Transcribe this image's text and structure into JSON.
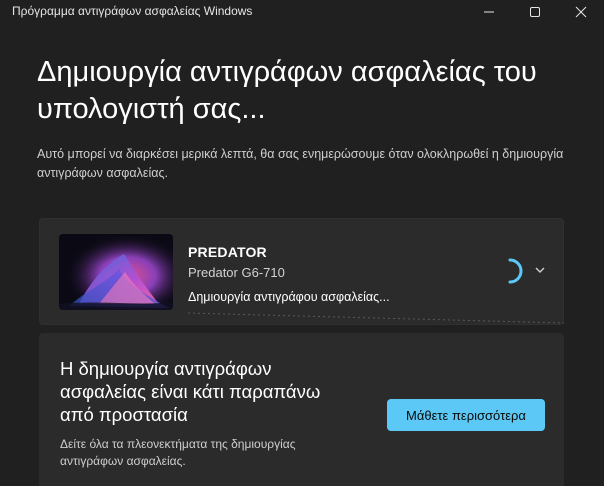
{
  "window": {
    "title": "Πρόγραμμα αντιγράφων ασφαλείας Windows"
  },
  "main": {
    "heading": "Δημιουργία αντιγράφων ασφαλείας του υπολογιστή σας...",
    "description": "Αυτό μπορεί να διαρκέσει μερικά λεπτά, θα σας ενημερώσουμε όταν ολοκληρωθεί η δημιουργία αντιγράφων ασφαλείας."
  },
  "device": {
    "name": "PREDATOR",
    "model": "Predator G6-710",
    "status": "Δημιουργία αντιγράφου ασφαλείας..."
  },
  "promo": {
    "title": "Η δημιουργία αντιγράφων ασφαλείας είναι κάτι παραπάνω από προστασία",
    "text": "Δείτε όλα τα πλεονεκτήματα της δημιουργίας αντιγράφων ασφαλείας.",
    "button_label": "Μάθετε περισσότερα"
  },
  "colors": {
    "background": "#202020",
    "card": "#2b2b2b",
    "accent": "#5cc8f5"
  },
  "icons": [
    "minimize-icon",
    "maximize-icon",
    "close-icon",
    "spinner-icon",
    "chevron-down-icon"
  ]
}
